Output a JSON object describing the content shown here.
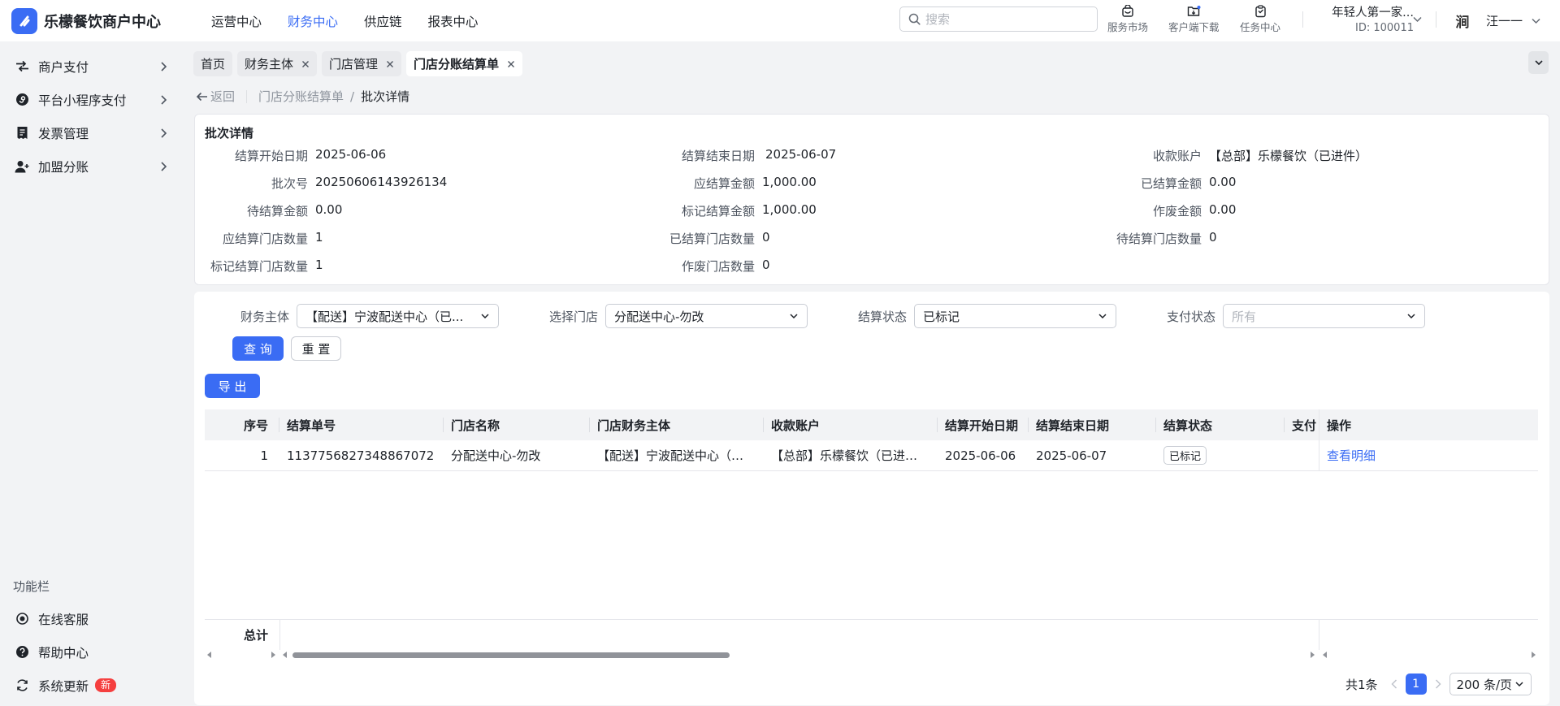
{
  "app": {
    "title": "乐檬餐饮商户中心",
    "nav": [
      "运营中心",
      "财务中心",
      "供应链",
      "报表中心"
    ],
    "nav_active": "财务中心",
    "search_placeholder": "搜索",
    "tools": [
      "服务市场",
      "客户端下载",
      "任务中心"
    ],
    "account_name": "年轻人第一家...",
    "account_id": "ID: 100011",
    "user_avatar_text": "涧",
    "user_name": "汪一一",
    "accent_color": "#3a6cf4"
  },
  "sidebar": {
    "items": [
      {
        "label": "商户支付",
        "icon": "swap-icon"
      },
      {
        "label": "平台小程序支付",
        "icon": "mini-program-icon"
      },
      {
        "label": "发票管理",
        "icon": "invoice-icon"
      },
      {
        "label": "加盟分账",
        "icon": "user-add-icon"
      }
    ],
    "func_title": "功能栏",
    "func_items": [
      {
        "label": "在线客服",
        "icon": "headset-icon"
      },
      {
        "label": "帮助中心",
        "icon": "help-icon"
      },
      {
        "label": "系统更新",
        "icon": "refresh-icon",
        "badge": "新"
      }
    ]
  },
  "tabs": [
    {
      "label": "首页",
      "closable": false
    },
    {
      "label": "财务主体",
      "closable": true
    },
    {
      "label": "门店管理",
      "closable": true
    },
    {
      "label": "门店分账结算单",
      "closable": true,
      "active": true
    }
  ],
  "breadcrumb": {
    "back": "返回",
    "items": [
      "门店分账结算单",
      "批次详情"
    ]
  },
  "detail": {
    "title": "批次详情",
    "rows": [
      [
        {
          "label": "结算开始日期",
          "value": "2025-06-06"
        },
        {
          "label": "结算结束日期",
          "value": "2025-06-07"
        },
        {
          "label": "收款账户",
          "value": "【总部】乐檬餐饮（已进件）"
        }
      ],
      [
        {
          "label": "批次号",
          "value": "20250606143926134"
        },
        {
          "label": "应结算金额",
          "value": "1,000.00"
        },
        {
          "label": "已结算金额",
          "value": "0.00"
        }
      ],
      [
        {
          "label": "待结算金额",
          "value": "0.00"
        },
        {
          "label": "标记结算金额",
          "value": "1,000.00"
        },
        {
          "label": "作废金额",
          "value": "0.00"
        }
      ],
      [
        {
          "label": "应结算门店数量",
          "value": "1"
        },
        {
          "label": "已结算门店数量",
          "value": "0"
        },
        {
          "label": "待结算门店数量",
          "value": "0"
        }
      ],
      [
        {
          "label": "标记结算门店数量",
          "value": "1"
        },
        {
          "label": "作废门店数量",
          "value": "0"
        }
      ]
    ]
  },
  "filters": [
    {
      "label": "财务主体",
      "value": "【配送】宁波配送中心（已...",
      "placeholder": false
    },
    {
      "label": "选择门店",
      "value": "分配送中心-勿改",
      "placeholder": false
    },
    {
      "label": "结算状态",
      "value": "已标记",
      "placeholder": false
    },
    {
      "label": "支付状态",
      "value": "所有",
      "placeholder": true
    }
  ],
  "buttons": {
    "query": "查 询",
    "reset": "重 置",
    "export": "导 出"
  },
  "table": {
    "columns": [
      "序号",
      "结算单号",
      "门店名称",
      "门店财务主体",
      "收款账户",
      "结算开始日期",
      "结算结束日期",
      "结算状态",
      "支付",
      "操作"
    ],
    "rows": [
      {
        "index": "1",
        "order_no": "1137756827348867072",
        "store_name": "分配送中心-勿改",
        "store_entity": "【配送】宁波配送中心（已进件）",
        "account": "【总部】乐檬餐饮（已进件）",
        "start_date": "2025-06-06",
        "end_date": "2025-06-07",
        "status": "已标记",
        "pay": "",
        "action": "查看明细"
      }
    ],
    "footer_label": "总计"
  },
  "pagination": {
    "total": "共1条",
    "current": "1",
    "page_size": "200 条/页"
  }
}
